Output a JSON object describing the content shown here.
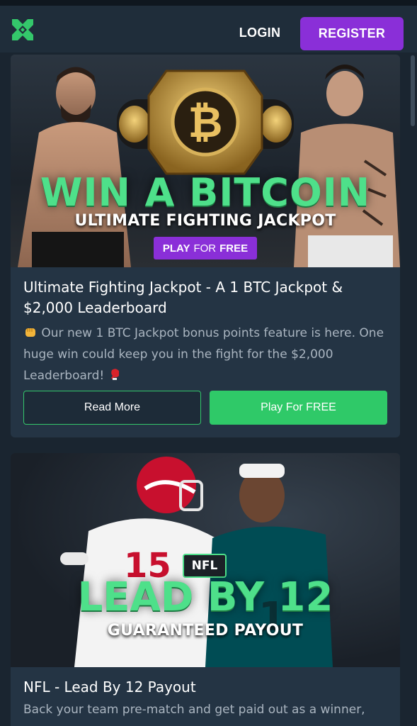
{
  "header": {
    "login_label": "LOGIN",
    "register_label": "REGISTER"
  },
  "colors": {
    "accent_green": "#4ee08a",
    "button_green": "#2fc968",
    "brand_purple": "#8a2fd8",
    "background": "#1a2530",
    "card": "#243444"
  },
  "promos": [
    {
      "banner": {
        "headline": "WIN A BITCOIN",
        "subheadline": "ULTIMATE FIGHTING JACKPOT",
        "badge_play": "PLAY",
        "badge_for": "FOR",
        "badge_free": "FREE"
      },
      "title": "Ultimate Fighting Jackpot - A 1 BTC Jackpot & $2,000 Leaderboard",
      "text_before": " Our new 1 BTC Jackpot bonus points feature is here. One huge win could keep you in the fight for the $2,000 Leaderboard! ",
      "read_more_label": "Read More",
      "play_label": "Play For FREE",
      "icons": [
        "fist-emoji-icon",
        "boxing-glove-icon"
      ]
    },
    {
      "banner": {
        "badge": "NFL",
        "headline": "LEAD BY 12",
        "subheadline": "GUARANTEED PAYOUT"
      },
      "title": "NFL - Lead By 12 Payout",
      "text": "Back your team pre-match and get paid out as a winner,"
    }
  ]
}
